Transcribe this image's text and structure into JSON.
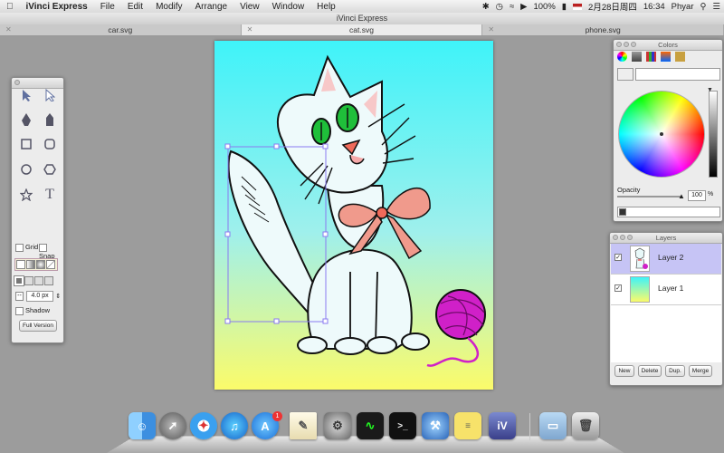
{
  "menubar": {
    "app_name": "iVinci Express",
    "items": [
      "File",
      "Edit",
      "Modify",
      "Arrange",
      "View",
      "Window",
      "Help"
    ],
    "battery": "100%",
    "date": "2月28日周四",
    "time": "16:34",
    "user": "Phyar"
  },
  "window": {
    "title": "iVinci Express",
    "tabs": [
      {
        "label": "car.svg",
        "active": false
      },
      {
        "label": "cat.svg",
        "active": true
      },
      {
        "label": "phone.svg",
        "active": false
      }
    ]
  },
  "toolbox": {
    "grid_label": "Grid",
    "snap_label": "Snap",
    "stroke_width": "4.0 px",
    "shadow_label": "Shadow",
    "full_version_label": "Full Version"
  },
  "colors_panel": {
    "title": "Colors",
    "opacity_label": "Opacity",
    "opacity_value": "100",
    "opacity_unit": "%"
  },
  "layers_panel": {
    "title": "Layers",
    "layers": [
      {
        "name": "Layer 2",
        "selected": true,
        "visible": true
      },
      {
        "name": "Layer 1",
        "selected": false,
        "visible": true
      }
    ],
    "buttons": [
      "New",
      "Delete",
      "Dup.",
      "Merge"
    ]
  },
  "dock": {
    "badge_count": "1",
    "apps": [
      "finder-icon",
      "launchpad-icon",
      "safari-icon",
      "itunes-icon",
      "app-store-icon",
      "textedit-icon",
      "system-preferences-icon",
      "activity-monitor-icon",
      "terminal-icon",
      "xcode-icon",
      "stickies-icon",
      "ivinci-icon",
      "folder-icon",
      "trash-icon"
    ]
  },
  "colors": {
    "canvas_top": "#3ff3f9",
    "canvas_bottom": "#fbfb6a",
    "selected_layer": "#c6c4f5",
    "yarn": "#d020c8",
    "bow": "#f08080"
  }
}
